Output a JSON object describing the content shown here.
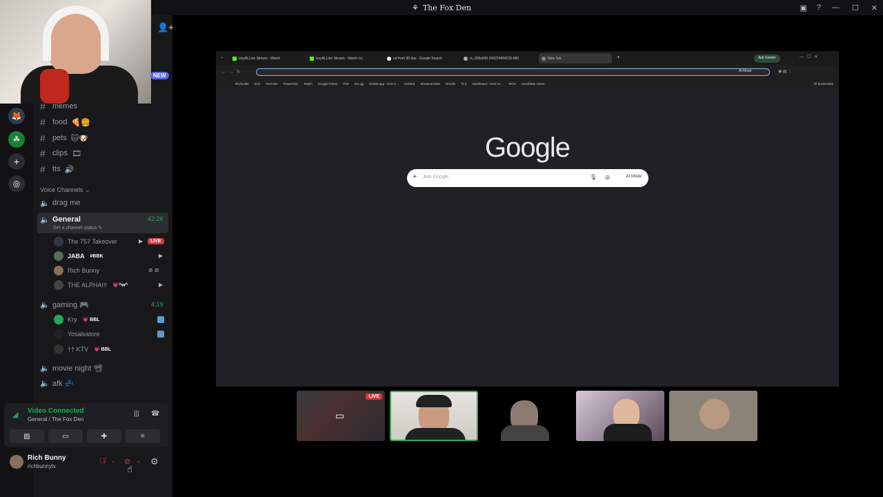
{
  "window": {
    "title": "The Fox Den"
  },
  "sidebar": {
    "new_badge": "NEW",
    "text_channels": [
      {
        "name": "memes",
        "emoji": ""
      },
      {
        "name": "food",
        "emoji": "🍕🍔"
      },
      {
        "name": "pets",
        "emoji": "🐱🐶"
      },
      {
        "name": "clips",
        "emoji": "🎞"
      },
      {
        "name": "tts",
        "emoji": "🔊"
      }
    ],
    "voice_category": "Voice Channels",
    "voice_channels": {
      "drag_me": "drag me",
      "general": {
        "name": "General",
        "status": "Set a channel status",
        "timer": "42:26"
      },
      "general_users": [
        {
          "name": "The 757 Takeover",
          "live": "LIVE"
        },
        {
          "name": "JABA",
          "tag": "#BBK"
        },
        {
          "name": "Rich Bunny"
        },
        {
          "name": "THE ALPHA!!!",
          "tag": "💗^w^"
        }
      ],
      "gaming": {
        "name": "gaming 🎮",
        "timer": "4:19"
      },
      "gaming_users": [
        {
          "name": "Kry",
          "tag": "💗 BBL"
        },
        {
          "name": "Yosalvatore"
        },
        {
          "name": "†† KTV",
          "tag": "💗 BBL"
        }
      ],
      "movie_night": "movie night 📽",
      "afk": "afk 💤"
    }
  },
  "voice_panel": {
    "status": "Video Connected",
    "channel": "General / The Fox Den"
  },
  "user": {
    "name": "Rich Bunny",
    "handle": "richbunnytv"
  },
  "browser": {
    "tabs": [
      "izzyALLinn Stream - Watch",
      "izzyALLinn Stream - Watch Liv",
      "ed from 90 day - Google Search",
      "rs_600x600-200224064215-600",
      "New Tab"
    ],
    "ask_gemini": "Ask Gemini",
    "ai_mode": "AI Mode",
    "bookmarks": [
      "IRLToolkit",
      "Kick",
      "YouTube",
      "Powerchat",
      "Twitch",
      "Google Forms",
      "Pixlr",
      "dsc.gg",
      "Kicklet.app - Kick C...",
      "KickBot",
      "StreamerStats",
      "Wordle",
      "TLS",
      "Dashboard - Kick As...",
      "WOS",
      "Candidate Home"
    ],
    "all_bookmarks": "All Bookmarks",
    "google_logo": "Google",
    "search_placeholder": "Ask Google",
    "search_ai_mode": "AI Mode"
  },
  "video_tiles": {
    "live_badge": "LIVE"
  },
  "colors": {
    "accent_green": "#23a55a",
    "live_red": "#da373c",
    "blurple": "#5865f2"
  }
}
